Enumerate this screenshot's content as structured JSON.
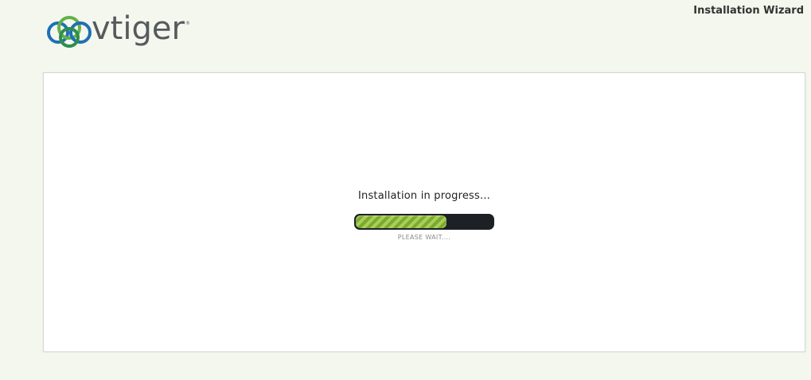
{
  "app": {
    "logo_text": "vtiger",
    "logo_mark": "®",
    "title": "Installation Wizard"
  },
  "main": {
    "status_text": "Installation in progress...",
    "progress": 0.66,
    "wait_text": "PLEASE WAIT...."
  },
  "colors": {
    "background": "#f3f7ed",
    "progress_green": "#8fbf3b",
    "progress_track": "#1d2125",
    "logo_blue": "#1f6fb4",
    "logo_green": "#63b14a",
    "logo_gray": "#555a5e"
  }
}
